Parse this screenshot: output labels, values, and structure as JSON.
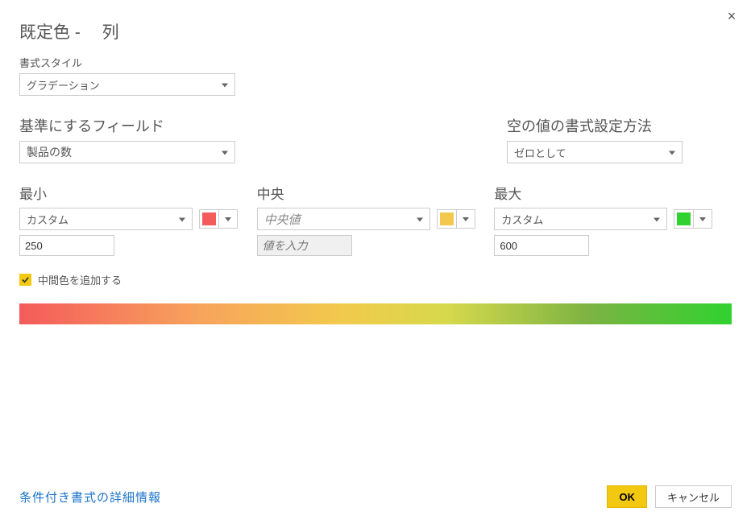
{
  "title": "既定色 - 　列",
  "close_icon": "×",
  "format_style": {
    "label": "書式スタイル",
    "value": "グラデーション"
  },
  "base_field": {
    "label": "基準にするフィールド",
    "value": "製品の数"
  },
  "empty_value": {
    "label": "空の値の書式設定方法",
    "value": "ゼロとして"
  },
  "min": {
    "label": "最小",
    "type": "カスタム",
    "value": "250",
    "color": "#f45b5b"
  },
  "center": {
    "label": "中央",
    "type": "中央値",
    "value_placeholder": "値を入力",
    "color": "#f2c94c"
  },
  "max": {
    "label": "最大",
    "type": "カスタム",
    "value": "600",
    "color": "#2fd22f"
  },
  "add_midcolor": {
    "label": "中間色を追加する",
    "checked": true
  },
  "footer": {
    "link": "条件付き書式の詳細情報",
    "ok": "OK",
    "cancel": "キャンセル"
  },
  "chart_data": {
    "type": "bar",
    "note": "gradient preview bar",
    "stops": [
      {
        "pos": 0,
        "color": "#f45b5b"
      },
      {
        "pos": 50,
        "color": "#f2c94c"
      },
      {
        "pos": 100,
        "color": "#2fd22f"
      }
    ]
  }
}
